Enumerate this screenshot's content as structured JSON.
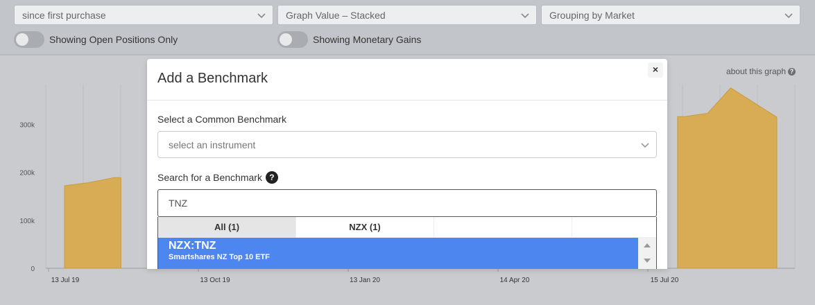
{
  "controls": {
    "period_select": "since first purchase",
    "graph_value_select": "Graph Value – Stacked",
    "grouping_select": "Grouping by Market",
    "toggle_open_positions_label": "Showing Open Positions Only",
    "toggle_monetary_label": "Showing Monetary Gains"
  },
  "chart": {
    "about_link": "about this graph",
    "about_icon": "question-circle-icon"
  },
  "modal": {
    "title": "Add a Benchmark",
    "close_label": "×",
    "common_label": "Select a Common Benchmark",
    "common_placeholder": "select an instrument",
    "search_label": "Search for a Benchmark",
    "help_icon": "?",
    "search_value": "TNZ",
    "tabs": [
      {
        "label": "All (1)",
        "active": true
      },
      {
        "label": "NZX (1)",
        "active": false
      }
    ],
    "results": [
      {
        "symbol": "NZX:TNZ",
        "name": "Smartshares NZ Top 10 ETF"
      }
    ]
  },
  "chart_data": {
    "type": "area",
    "title": "",
    "xlabel": "",
    "ylabel": "",
    "ylim": [
      0,
      380000
    ],
    "y_ticks": [
      "0",
      "100k",
      "200k",
      "300k"
    ],
    "x_ticks": [
      "13 Jul 19",
      "13 Oct 19",
      "13 Jan 20",
      "14 Apr 20",
      "15 Jul 20"
    ],
    "series": [
      {
        "color": "#d8ac54",
        "points_left": [
          [
            0,
            172000
          ],
          [
            14,
            178000
          ],
          [
            30,
            189000
          ]
        ],
        "points_right": [
          [
            376,
            316000
          ],
          [
            390,
            323000
          ],
          [
            404,
            376000
          ],
          [
            432,
            315000
          ]
        ]
      }
    ],
    "x_range_days": [
      0,
      432
    ],
    "grid": true
  }
}
